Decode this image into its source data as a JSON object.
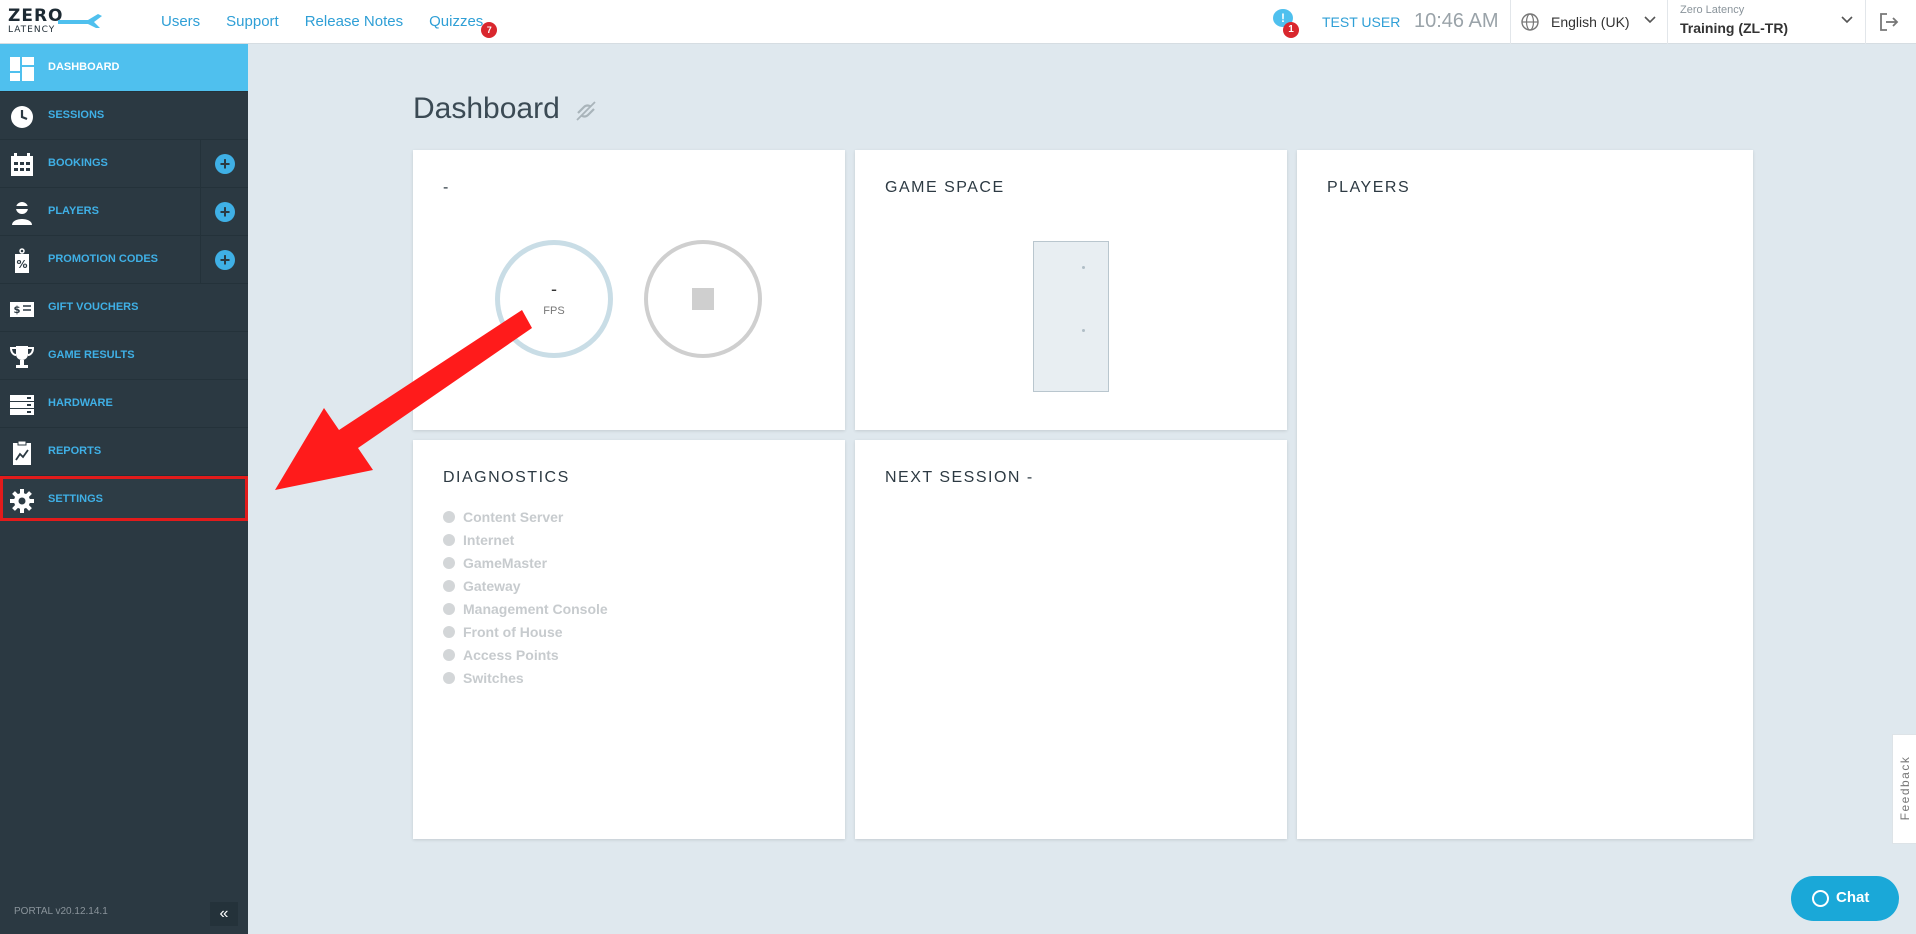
{
  "header": {
    "logo_top": "ZERO",
    "logo_bottom": "LATENCY",
    "nav": [
      {
        "label": "Users"
      },
      {
        "label": "Support"
      },
      {
        "label": "Release Notes"
      },
      {
        "label": "Quizzes",
        "badge": "7"
      }
    ],
    "notification_icon": "!",
    "notification_count": "1",
    "user": "TEST USER",
    "time": "10:46 AM",
    "language": "English (UK)",
    "site_org": "Zero Latency",
    "site_name": "Training (ZL-TR)"
  },
  "sidebar": {
    "items": [
      {
        "label": "DASHBOARD",
        "icon": "dashboard-icon"
      },
      {
        "label": "SESSIONS",
        "icon": "clock-icon"
      },
      {
        "label": "BOOKINGS",
        "icon": "calendar-icon"
      },
      {
        "label": "PLAYERS",
        "icon": "player-icon"
      },
      {
        "label": "PROMOTION CODES",
        "icon": "promo-tag-icon"
      },
      {
        "label": "GIFT VOUCHERS",
        "icon": "voucher-icon"
      },
      {
        "label": "GAME RESULTS",
        "icon": "trophy-icon"
      },
      {
        "label": "HARDWARE",
        "icon": "server-icon"
      },
      {
        "label": "REPORTS",
        "icon": "report-icon"
      },
      {
        "label": "SETTINGS",
        "icon": "gear-icon"
      }
    ],
    "version": "PORTAL v20.12.14.1",
    "collapse_glyph": "«"
  },
  "main": {
    "title": "Dashboard",
    "cards": {
      "status": {
        "title": "-",
        "fps_value": "-",
        "fps_label": "FPS"
      },
      "game_space": {
        "title": "GAME SPACE"
      },
      "players": {
        "title": "PLAYERS"
      },
      "diagnostics": {
        "title": "DIAGNOSTICS",
        "items": [
          "Content Server",
          "Internet",
          "GameMaster",
          "Gateway",
          "Management Console",
          "Front of House",
          "Access Points",
          "Switches"
        ]
      },
      "next_session": {
        "title": "NEXT SESSION -"
      }
    }
  },
  "widgets": {
    "feedback": "Feedback",
    "chat": "Chat"
  },
  "colors": {
    "accent": "#4fc0ee",
    "link": "#2f9fd6",
    "sidebar_bg": "#2b3942",
    "badge": "#d9272e",
    "highlight": "#e21b1b"
  }
}
